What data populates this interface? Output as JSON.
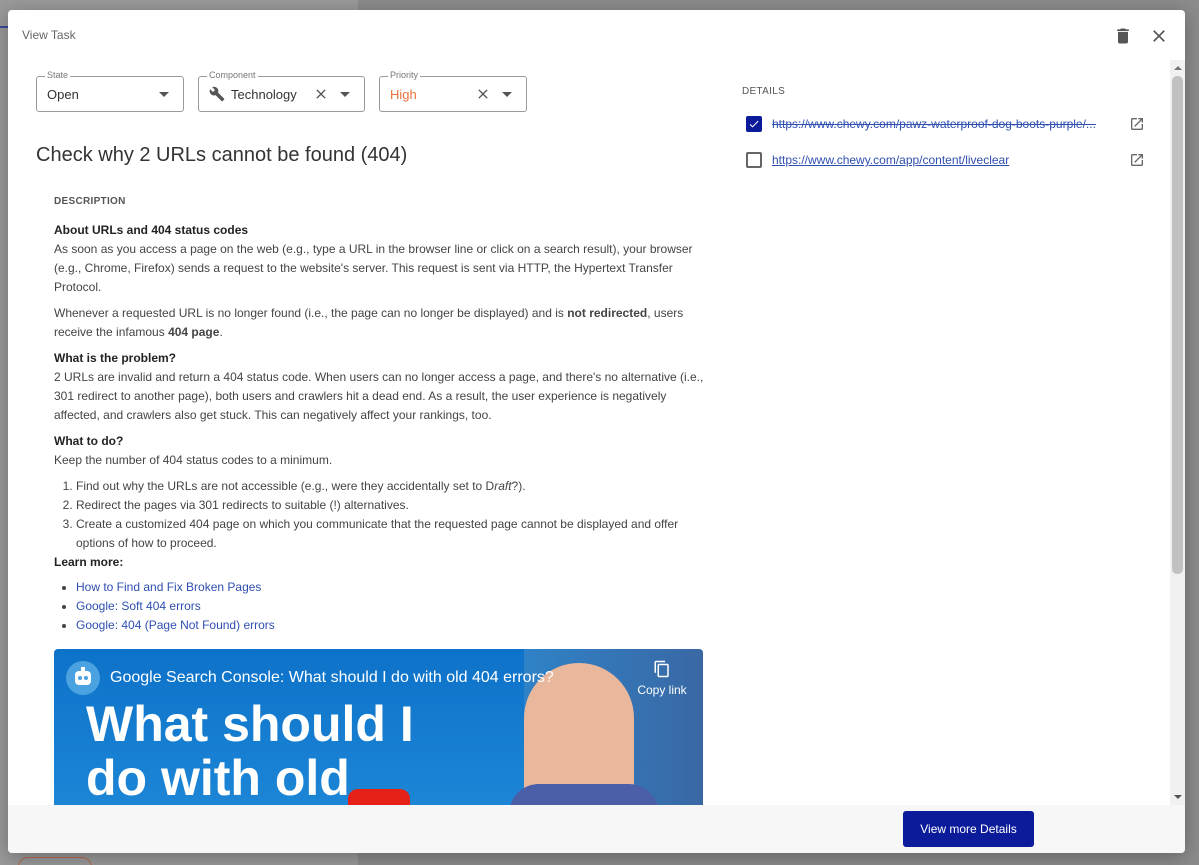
{
  "modal": {
    "title": "View Task",
    "delete_icon": "trash-icon",
    "close_icon": "close-icon"
  },
  "fields": {
    "state": {
      "label": "State",
      "value": "Open"
    },
    "component": {
      "label": "Component",
      "value": "Technology",
      "icon": "wrench-icon"
    },
    "priority": {
      "label": "Priority",
      "value": "High",
      "color": "#e8703a"
    }
  },
  "task": {
    "title": "Check why 2 URLs cannot be found (404)"
  },
  "description": {
    "heading": "DESCRIPTION",
    "s1_title": "About URLs and 404 status codes",
    "s1_p1": "As soon as you access a page on the web (e.g., type a URL in the browser line or click on a search result), your browser (e.g., Chrome, Firefox) sends a request to the website's server. This request is sent via HTTP, the Hypertext Transfer Protocol.",
    "s1_p2_a": "Whenever a requested URL is no longer found (i.e., the page can no longer be displayed) and is ",
    "s1_p2_b": "not redirected",
    "s1_p2_c": ", users receive the infamous ",
    "s1_p2_d": "404 page",
    "s1_p2_e": ".",
    "s2_title": "What is the problem?",
    "s2_p1": "2 URLs are invalid and return a 404 status code. When users can no longer access a page, and there's no alternative (i.e., 301 redirect to another page), both users and crawlers hit a dead end. As a result, the user experience is negatively affected, and crawlers also get stuck. This can negatively affect your rankings, too.",
    "s3_title": "What to do?",
    "s3_p1": "Keep the number of 404 status codes to a minimum.",
    "steps": [
      {
        "a": "Find out why the URLs are not accessible (e.g., were they accidentally set to D",
        "b": "raft",
        "c": "?)."
      },
      {
        "text": "Redirect the pages via 301 redirects to suitable (!) alternatives."
      },
      {
        "text": "Create a customized 404 page on which you communicate that the requested page cannot be displayed and offer options of how to proceed."
      }
    ],
    "learn_more": "Learn more:",
    "links": [
      "How to Find and Fix Broken Pages",
      "Google: Soft 404 errors",
      "Google: 404 (Page Not Found) errors"
    ]
  },
  "video": {
    "title": "Google Search Console: What should I do with old 404 errors?",
    "big_line1": "What should I",
    "big_line2": "do with old",
    "copy_label": "Copy link"
  },
  "details": {
    "heading": "DETAILS",
    "items": [
      {
        "url": "https://www.chewy.com/pawz-waterproof-dog-boots-purple/...",
        "checked": true
      },
      {
        "url": "https://www.chewy.com/app/content/liveclear",
        "checked": false
      }
    ]
  },
  "footer": {
    "more_label": "View more Details"
  },
  "colors": {
    "primary": "#0b1b9a",
    "link": "#2f4fb0",
    "priority_high": "#e8703a"
  }
}
